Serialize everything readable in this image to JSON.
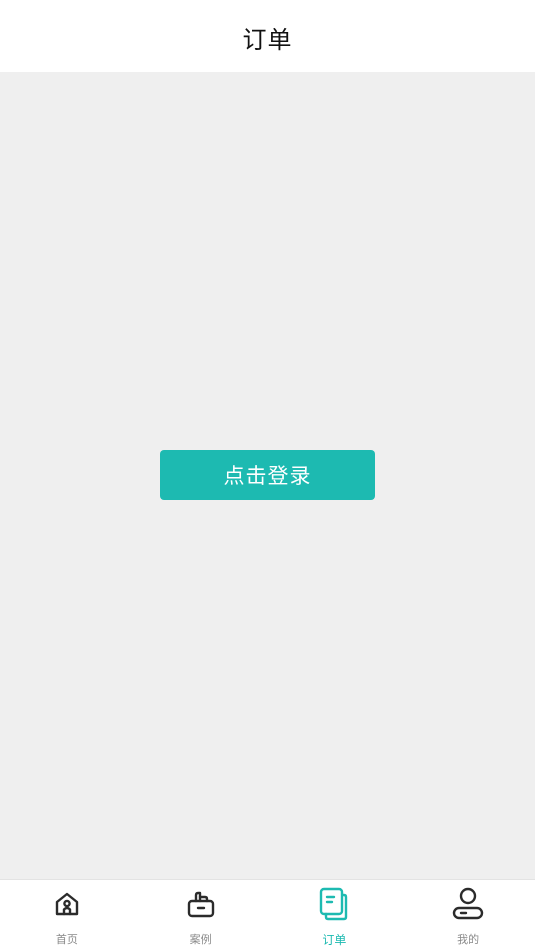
{
  "header": {
    "title": "订单"
  },
  "main": {
    "login_button_label": "点击登录"
  },
  "tabbar": {
    "active_index": 2,
    "items": [
      {
        "label": "首页",
        "icon": "home-icon"
      },
      {
        "label": "案例",
        "icon": "case-icon"
      },
      {
        "label": "订单",
        "icon": "order-icon"
      },
      {
        "label": "我的",
        "icon": "profile-icon"
      }
    ]
  },
  "colors": {
    "accent": "#1dbab1",
    "background": "#efefef",
    "inactive_tab": "#8a8a8a"
  }
}
